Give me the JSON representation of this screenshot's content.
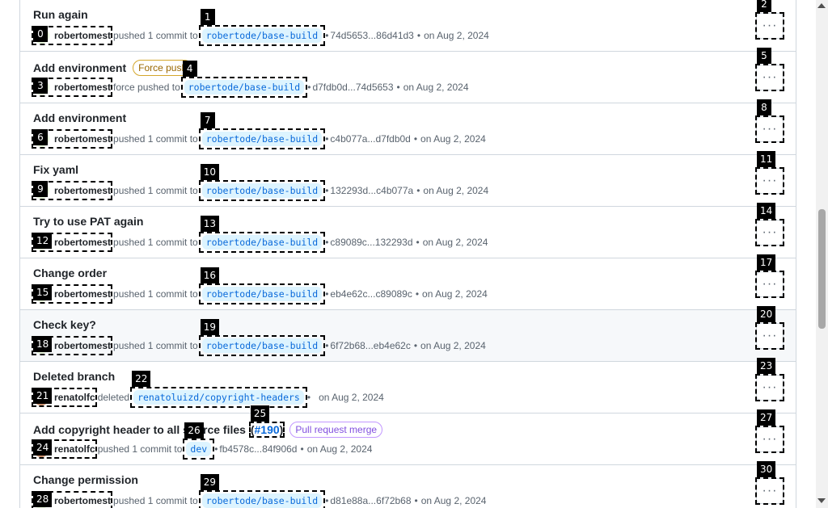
{
  "activity": [
    {
      "title": "Run again",
      "user": "robertomest",
      "avatar": "green",
      "action": "pushed 1 commit to",
      "branch": "robertode/base-build",
      "range": "74d5653...86d41d3",
      "date": "on Aug 2, 2024",
      "badge": ""
    },
    {
      "title": "Add environment",
      "user": "robertomest",
      "avatar": "green",
      "action": "force pushed to",
      "branch": "robertode/base-build",
      "range": "d7fdb0d...74d5653",
      "date": "on Aug 2, 2024",
      "badge": "Force push"
    },
    {
      "title": "Add environment",
      "user": "robertomest",
      "avatar": "green",
      "action": "pushed 1 commit to",
      "branch": "robertode/base-build",
      "range": "c4b077a...d7fdb0d",
      "date": "on Aug 2, 2024",
      "badge": ""
    },
    {
      "title": "Fix yaml",
      "user": "robertomest",
      "avatar": "green",
      "action": "pushed 1 commit to",
      "branch": "robertode/base-build",
      "range": "132293d...c4b077a",
      "date": "on Aug 2, 2024",
      "badge": ""
    },
    {
      "title": "Try to use PAT again",
      "user": "robertomest",
      "avatar": "green",
      "action": "pushed 1 commit to",
      "branch": "robertode/base-build",
      "range": "c89089c...132293d",
      "date": "on Aug 2, 2024",
      "badge": ""
    },
    {
      "title": "Change order",
      "user": "robertomest",
      "avatar": "green",
      "action": "pushed 1 commit to",
      "branch": "robertode/base-build",
      "range": "eb4e62c...c89089c",
      "date": "on Aug 2, 2024",
      "badge": ""
    },
    {
      "title": "Check key?",
      "user": "robertomest",
      "avatar": "green",
      "action": "pushed 1 commit to",
      "branch": "robertode/base-build",
      "range": "6f72b68...eb4e62c",
      "date": "on Aug 2, 2024",
      "badge": ""
    },
    {
      "title": "Deleted branch",
      "user": "renatolfc",
      "avatar": "face",
      "action": "deleted",
      "branch": "renatoluizd/copyright-headers",
      "range": "",
      "date": "on Aug 2, 2024",
      "badge": ""
    },
    {
      "title": "Add copyright header to all source files",
      "pr": "#190",
      "user": "renatolfc",
      "avatar": "face",
      "action": "pushed 1 commit to",
      "branch": "dev",
      "range": "fb4578c...84f906d",
      "date": "on Aug 2, 2024",
      "badge": "Pull request merge"
    },
    {
      "title": "Change permission",
      "user": "robertomest",
      "avatar": "green",
      "action": "pushed 1 commit to",
      "branch": "robertode/base-build",
      "range": "d81e88a...6f72b68",
      "date": "on Aug 2, 2024",
      "badge": ""
    }
  ],
  "kebab_label": "···",
  "annotation_tags": [
    "0",
    "1",
    "2",
    "3",
    "4",
    "5",
    "6",
    "7",
    "8",
    "9",
    "10",
    "11",
    "12",
    "13",
    "14",
    "15",
    "16",
    "17",
    "18",
    "19",
    "20",
    "21",
    "22",
    "23",
    "24",
    "25",
    "26",
    "27",
    "28",
    "29",
    "30"
  ]
}
